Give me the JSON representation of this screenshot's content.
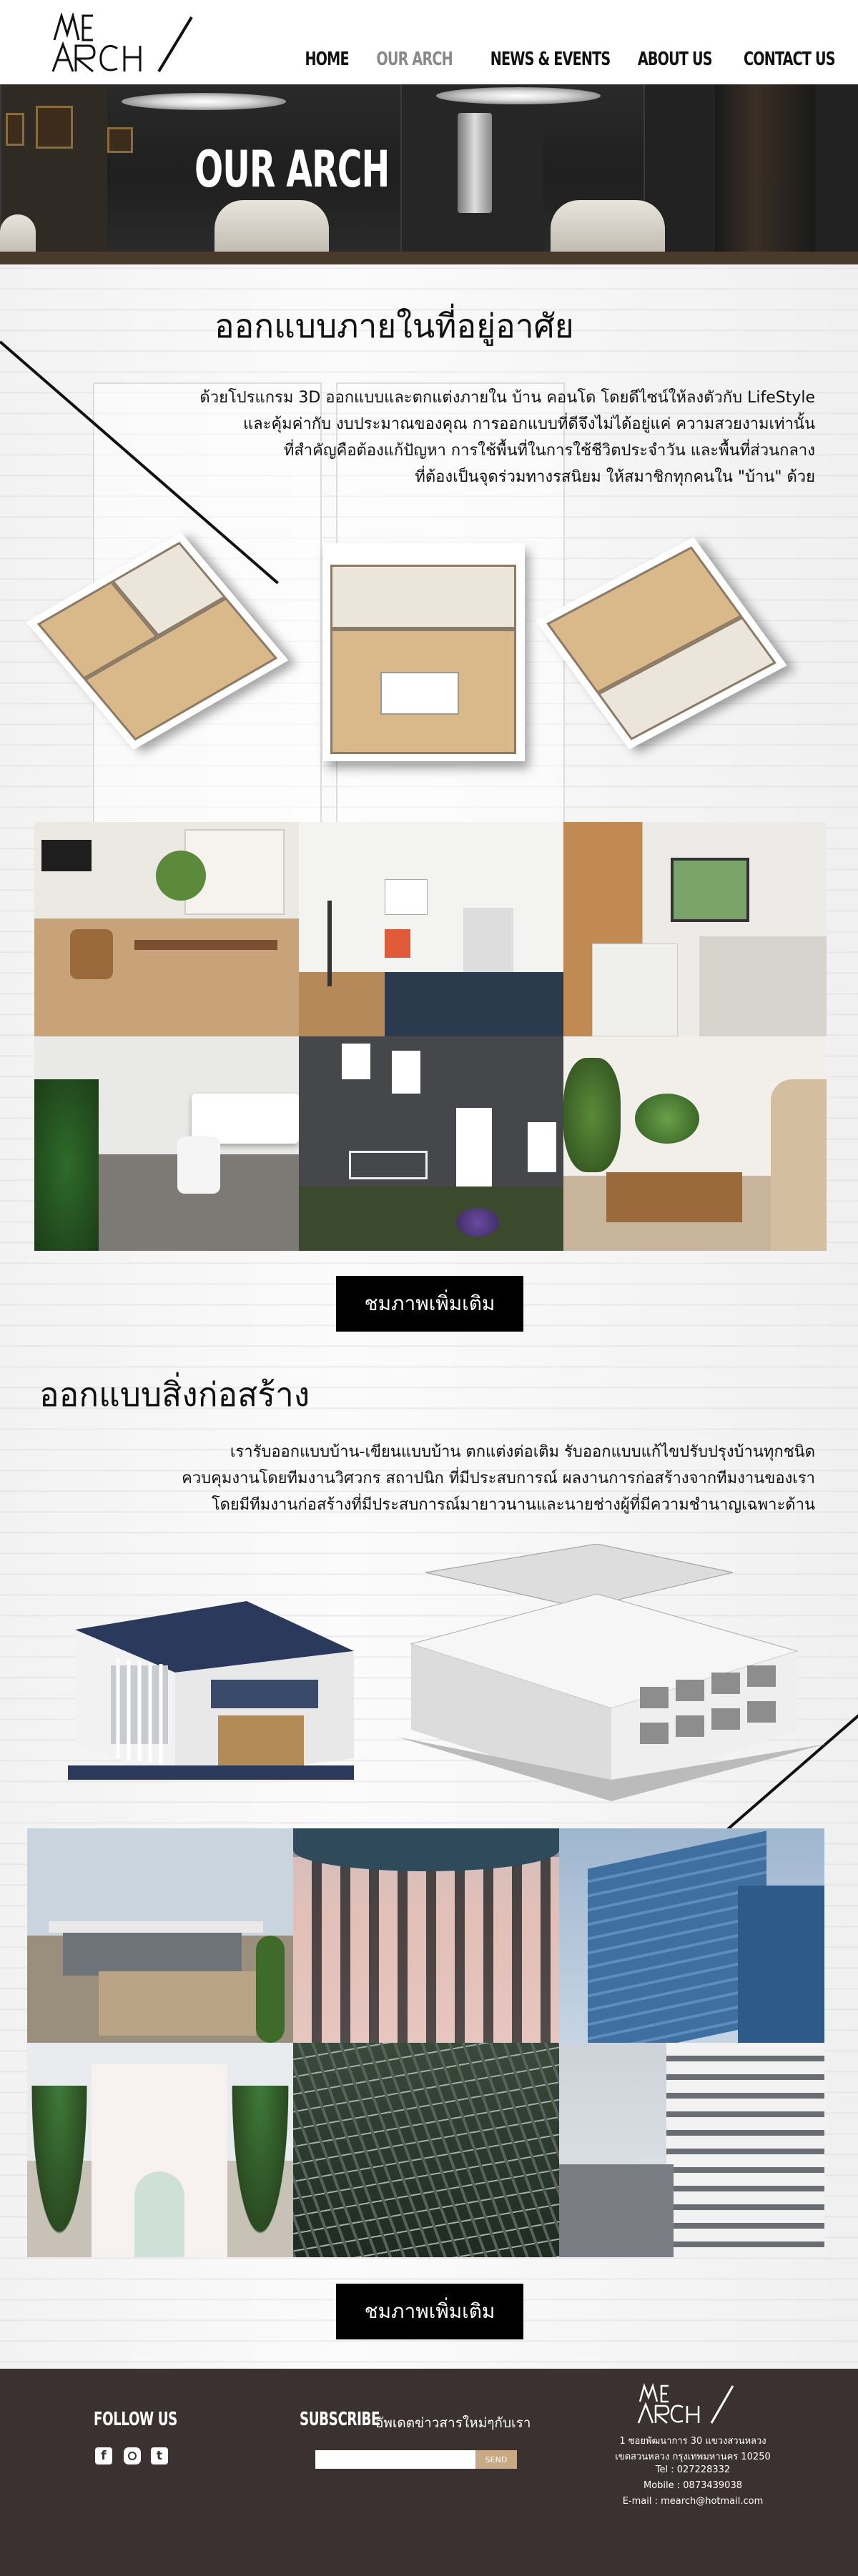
{
  "brand": {
    "logo_top": "ME",
    "logo_bottom": "ARCH"
  },
  "nav": {
    "items": [
      {
        "label": "HOME"
      },
      {
        "label": "OUR ARCH"
      },
      {
        "label": "NEWS & EVENTS"
      },
      {
        "label": "ABOUT US"
      },
      {
        "label": "CONTACT US"
      }
    ],
    "active": "OUR ARCH"
  },
  "hero": {
    "title": "OUR ARCH"
  },
  "interior": {
    "title": "ออกแบบภายในที่อยู่อาศัย",
    "lines": [
      "ด้วยโปรแกรม 3D ออกแบบและตกแต่งภายใน บ้าน คอนโด โดยดีไซน์ให้ลงตัวกับ LifeStyle",
      "และคุ้มค่ากับ งบประมาณของคุณ การออกแบบที่ดีจึงไม่ได้อยู่แค่ ความสวยงามเท่านั้น",
      "ที่สำคัญคือต้องแก้ปัญหา การใช้พื้นที่ในการใช้ชีวิตประจำวัน และพื้นที่ส่วนกลาง",
      "ที่ต้องเป็นจุดร่วมทางรสนิยม ให้สมาชิกทุกคนใน \"บ้าน\" ด้วย"
    ],
    "more_button": "ชมภาพเพิ่มเติม"
  },
  "construction": {
    "title": "ออกแบบสิ่งก่อสร้าง",
    "lines": [
      "เรารับออกแบบบ้าน-เขียนแบบบ้าน ตกแต่งต่อเติม รับออกแบบแก้ไขปรับปรุงบ้านทุกชนิด",
      "ควบคุมงานโดยทีมงานวิศวกร สถาปนิก ที่มีประสบการณ์ ผลงานการก่อสร้างจากทีมงานของเรา",
      "โดยมีทีมงานก่อสร้างที่มีประสบการณ์มายาวนานและนายช่างผู้ที่มีความชำนาญเฉพาะด้าน"
    ],
    "more_button": "ชมภาพเพิ่มเติม"
  },
  "footer": {
    "follow_title": "FOLLOW US",
    "subscribe_title": "SUBSCRIBE",
    "subscribe_text": "อัพเดตข่าวสารใหม่ๆกับเรา",
    "email_placeholder": "",
    "send_label": "SEND",
    "address_line1": "1 ซอยพัฒนาการ 30 แขวงสวนหลวง",
    "address_line2": "เขตสวนหลวง กรุงเทพมหานคร 10250",
    "tel": "Tel : 027228332",
    "mobile": "Mobile : 0873439038",
    "email": "E-mail : mearch@hotmail.com"
  },
  "colors": {
    "footer_bg": "#3a3130",
    "button_bg": "#000000",
    "send_bg": "#c9a884",
    "nav_active": "#8a8a8a"
  }
}
